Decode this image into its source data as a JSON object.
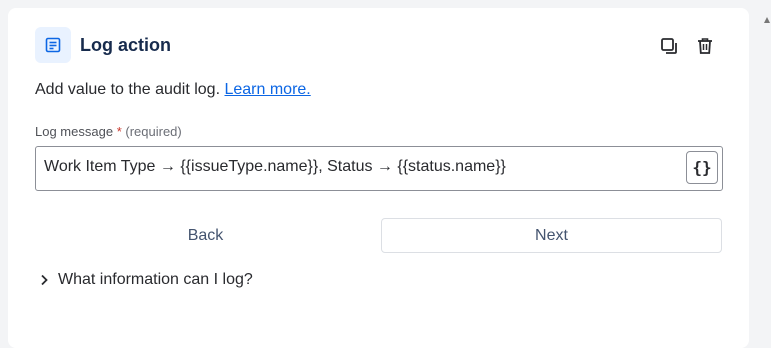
{
  "panel": {
    "title": "Log action",
    "icon": "document-icon",
    "actions": {
      "duplicate_icon": "copy-icon",
      "delete_icon": "trash-icon"
    }
  },
  "description": {
    "text": "Add value to the audit log.",
    "link_label": "Learn more."
  },
  "field": {
    "label": "Log message",
    "required_marker": "*",
    "required_text": "(required)",
    "value": "Work Item Type → {{issueType.name}}, Status → {{status.name}}",
    "smart_value_button": "{}"
  },
  "buttons": {
    "back_label": "Back",
    "next_label": "Next"
  },
  "expander": {
    "label": "What information can I log?",
    "icon": "chevron-right-icon"
  },
  "colors": {
    "link": "#0c66e4",
    "icon_bg": "#e9f2ff",
    "icon_fg": "#0c66e4",
    "required": "#c9372c"
  }
}
